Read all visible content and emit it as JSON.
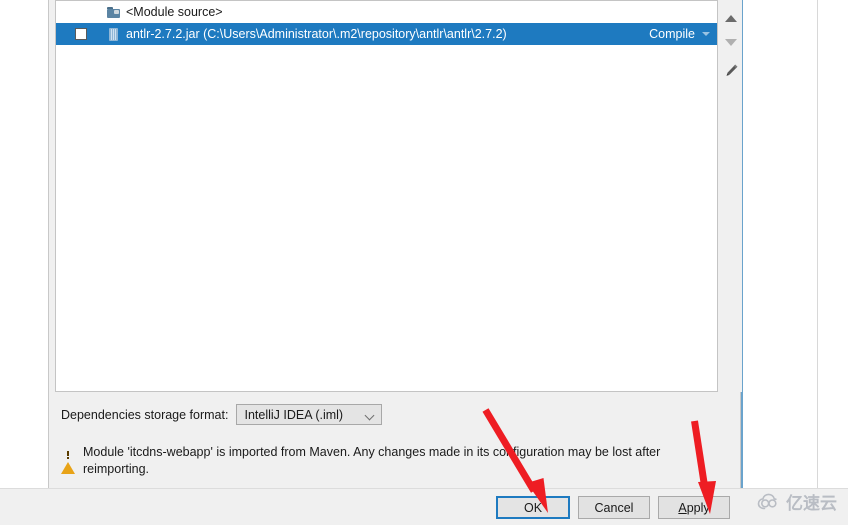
{
  "dialog": {
    "list": {
      "rows": [
        {
          "type": "module-source",
          "icon": "folder-icon",
          "label": "<Module source>",
          "scope": "",
          "checked": false,
          "selected": false
        },
        {
          "type": "library",
          "icon": "jar-icon",
          "label": "antlr-2.7.2.jar (C:\\Users\\Administrator\\.m2\\repository\\antlr\\antlr\\2.7.2)",
          "scope": "Compile",
          "checked": false,
          "selected": true
        }
      ]
    },
    "side_toolbar": {
      "move_up": "move-up",
      "move_down": "move-down",
      "edit": "edit"
    },
    "storage": {
      "label": "Dependencies storage format:",
      "value": "IntelliJ IDEA (.iml)"
    },
    "warning": {
      "text": "Module 'itcdns-webapp' is imported from Maven. Any changes made in its configuration may be lost after reimporting."
    },
    "buttons": {
      "ok": "OK",
      "cancel": "Cancel",
      "apply_prefix": "A",
      "apply_rest": "pply"
    }
  },
  "watermark": {
    "text": "亿速云"
  },
  "colors": {
    "selection_blue": "#1e7ac0",
    "warning_orange": "#e8a317",
    "annotation_red": "#ee1d23",
    "dialog_gray": "#f0f0f0"
  }
}
